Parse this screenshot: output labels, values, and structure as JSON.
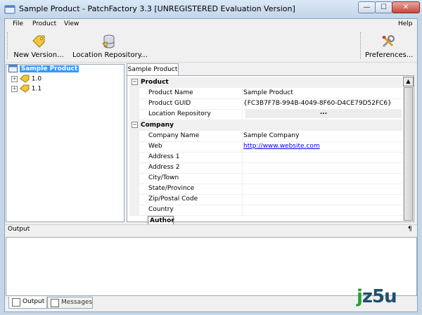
{
  "window": {
    "title": "Sample Product  -  PatchFactory 3.3  [UNREGISTERED Evaluation Version]",
    "controls": {
      "minimize": "—",
      "maximize": "☐",
      "close": "✕"
    }
  },
  "menubar": {
    "file": "File",
    "product": "Product",
    "view": "View",
    "help": "Help"
  },
  "toolbar": {
    "new_version": "New Version...",
    "location_repository": "Location Repository...",
    "preferences": "Preferences..."
  },
  "tree": {
    "root": "Sample Product",
    "children": [
      "1.0",
      "1.1"
    ]
  },
  "tab_label": "Sample Product",
  "properties": {
    "product_category": "Product",
    "product_rows": [
      {
        "name": "Product Name",
        "value": "Sample Product"
      },
      {
        "name": "Product GUID",
        "value": "{FC3B7F7B-994B-4049-8F60-D4CE79D52FC6}"
      },
      {
        "name": "Location Repository",
        "value": "..."
      }
    ],
    "company_category": "Company",
    "company_rows": [
      {
        "name": "Company Name",
        "value": "Sample Company"
      },
      {
        "name": "Web",
        "value": "http://www.website.com"
      },
      {
        "name": "Address 1",
        "value": ""
      },
      {
        "name": "Address 2",
        "value": ""
      },
      {
        "name": "City/Town",
        "value": ""
      },
      {
        "name": "State/Province",
        "value": ""
      },
      {
        "name": "Zip/Postal Code",
        "value": ""
      },
      {
        "name": "Country",
        "value": ""
      }
    ]
  },
  "tooltip": "Author",
  "output": {
    "title": "Output",
    "pin": "¶"
  },
  "bottom_tabs": {
    "output": "Output",
    "messages": "Messages"
  },
  "watermark": {
    "j": "j",
    "rest": "z5u"
  },
  "colors": {
    "selection": "#3399ff",
    "link": "#0000ee",
    "titlebar": "#c3d5ea"
  }
}
